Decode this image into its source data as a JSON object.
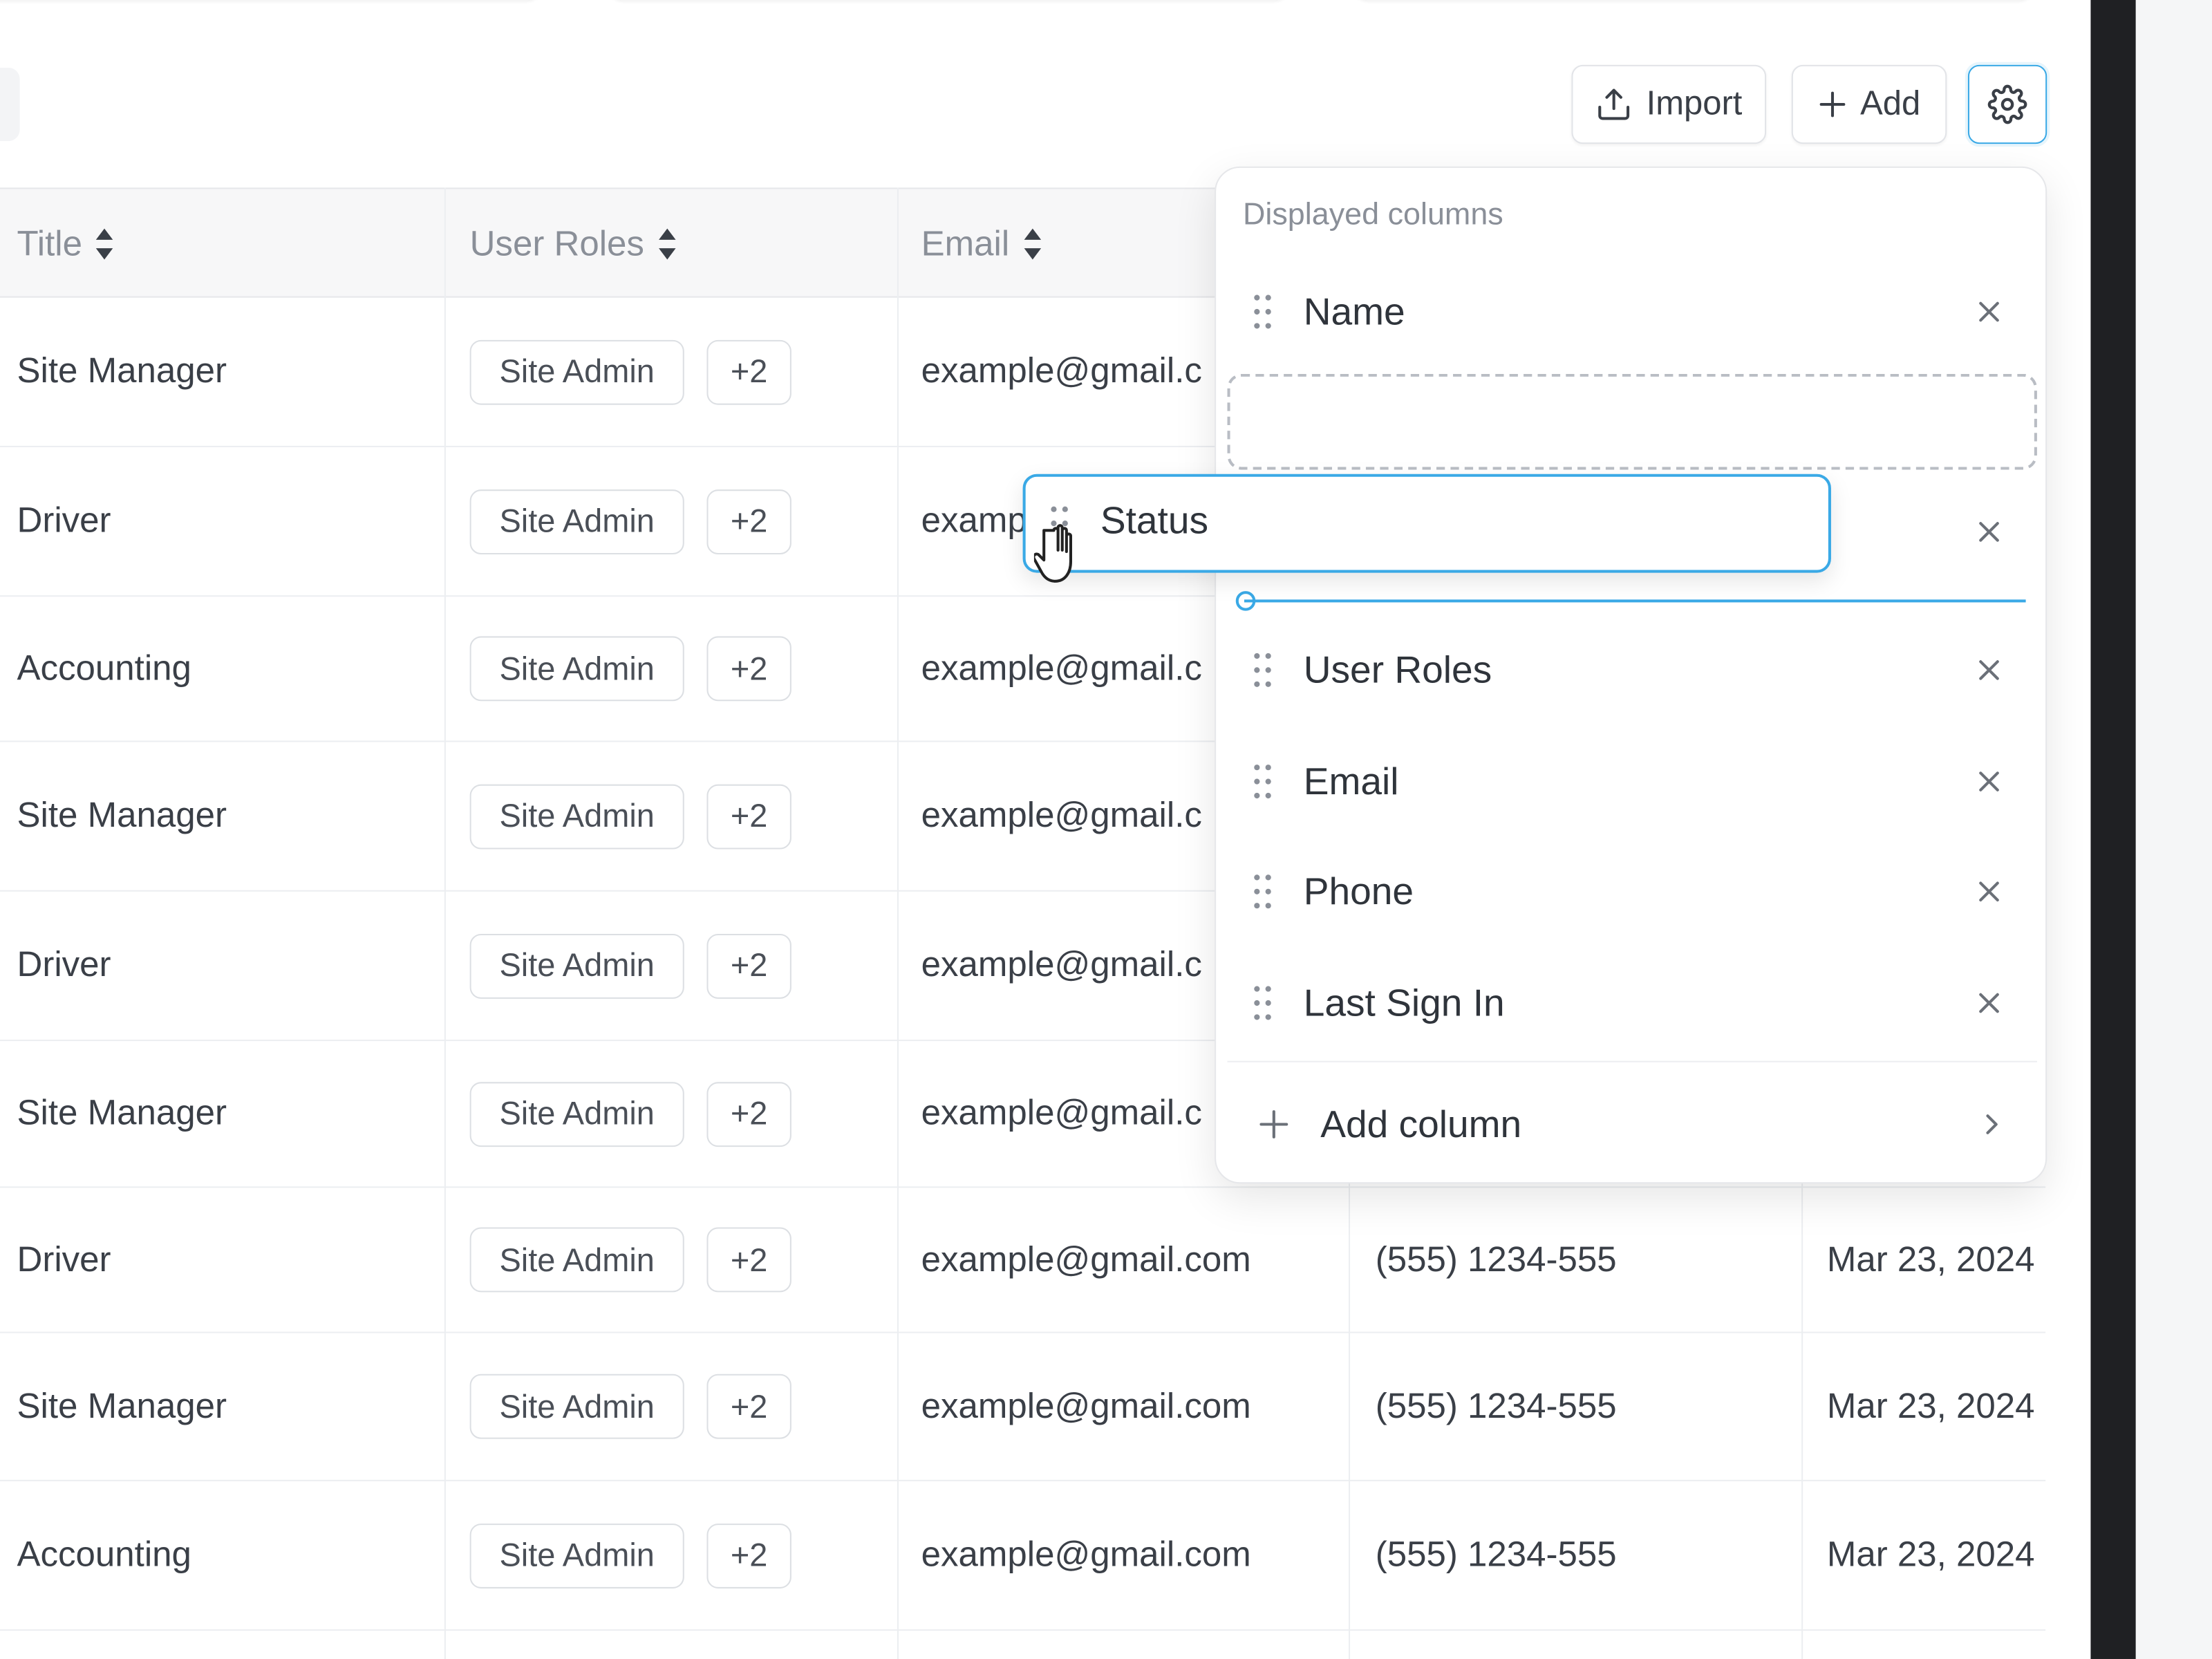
{
  "toolbar": {
    "import_label": "Import",
    "add_label": "Add",
    "settings_icon": "gear-icon",
    "accent": "#3aa9e6"
  },
  "table": {
    "headers": {
      "title": "Title",
      "user_roles": "User Roles",
      "email": "Email"
    },
    "rows": [
      {
        "title": "Site Manager",
        "role": "Site Admin",
        "more": "+2",
        "email": "example@gmail.c",
        "phone": "",
        "last_sign_in": ""
      },
      {
        "title": "Driver",
        "role": "Site Admin",
        "more": "+2",
        "email": "examp",
        "phone": "",
        "last_sign_in": ""
      },
      {
        "title": "Accounting",
        "role": "Site Admin",
        "more": "+2",
        "email": "example@gmail.c",
        "phone": "",
        "last_sign_in": ""
      },
      {
        "title": "Site Manager",
        "role": "Site Admin",
        "more": "+2",
        "email": "example@gmail.c",
        "phone": "",
        "last_sign_in": ""
      },
      {
        "title": "Driver",
        "role": "Site Admin",
        "more": "+2",
        "email": "example@gmail.c",
        "phone": "",
        "last_sign_in": ""
      },
      {
        "title": "Site Manager",
        "role": "Site Admin",
        "more": "+2",
        "email": "example@gmail.c",
        "phone": "",
        "last_sign_in": ""
      },
      {
        "title": "Driver",
        "role": "Site Admin",
        "more": "+2",
        "email": "example@gmail.com",
        "phone": "(555) 1234-555",
        "last_sign_in": "Mar 23, 2024"
      },
      {
        "title": "Site Manager",
        "role": "Site Admin",
        "more": "+2",
        "email": "example@gmail.com",
        "phone": "(555) 1234-555",
        "last_sign_in": "Mar 23, 2024"
      },
      {
        "title": "Accounting",
        "role": "Site Admin",
        "more": "+2",
        "email": "example@gmail.com",
        "phone": "(555) 1234-555",
        "last_sign_in": "Mar 23, 2024"
      }
    ]
  },
  "popover": {
    "title": "Displayed columns",
    "columns": [
      "Name",
      "User Roles",
      "Email",
      "Phone",
      "Last Sign In"
    ],
    "hidden_row_close": "",
    "dragging": "Status",
    "add_column_label": "Add column"
  }
}
